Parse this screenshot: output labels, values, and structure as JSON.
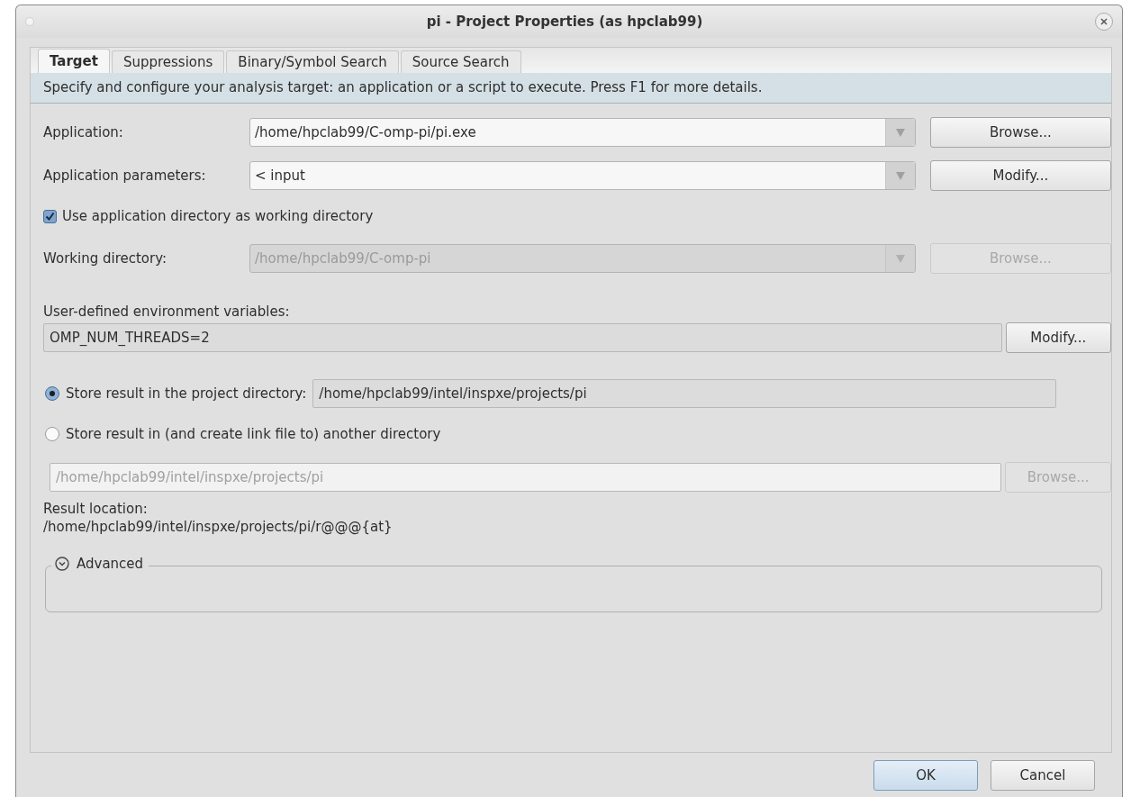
{
  "window": {
    "title": "pi - Project Properties (as hpclab99)"
  },
  "tabs": [
    {
      "label": "Target",
      "selected": true
    },
    {
      "label": "Suppressions",
      "selected": false
    },
    {
      "label": "Binary/Symbol Search",
      "selected": false
    },
    {
      "label": "Source Search",
      "selected": false
    }
  ],
  "info": "Specify and configure your analysis target: an application or a script to execute. Press F1 for more details.",
  "combo_rows": [
    {
      "label": "Application:",
      "value": "/home/hpclab99/C-omp-pi/pi.exe",
      "disabled": false,
      "button": {
        "label": "Browse...",
        "disabled": false
      }
    },
    {
      "label": "Application parameters:",
      "value": "< input",
      "disabled": false,
      "button": {
        "label": "Modify...",
        "disabled": false
      }
    }
  ],
  "use_app_dir": {
    "label": "Use application directory as working directory",
    "checked": true
  },
  "working_directory": {
    "label": "Working directory:",
    "value": "/home/hpclab99/C-omp-pi",
    "disabled": true,
    "button": {
      "label": "Browse...",
      "disabled": true
    }
  },
  "environment": {
    "label": "User-defined environment variables:",
    "value": "OMP_NUM_THREADS=2",
    "button": {
      "label": "Modify...",
      "disabled": false
    }
  },
  "store_options": [
    {
      "label": "Store result in the project directory:",
      "selected": true,
      "value": "/home/hpclab99/intel/inspxe/projects/pi"
    },
    {
      "label": "Store result in (and create link file to) another directory",
      "selected": false
    }
  ],
  "other_directory": {
    "value": "/home/hpclab99/intel/inspxe/projects/pi",
    "disabled": true,
    "button": {
      "label": "Browse...",
      "disabled": true
    }
  },
  "result_location": {
    "label": "Result location:",
    "value": "/home/hpclab99/intel/inspxe/projects/pi/r@@@{at}"
  },
  "advanced": {
    "label": "Advanced",
    "expanded": false
  },
  "buttons": [
    {
      "label": "OK",
      "default": true
    },
    {
      "label": "Cancel",
      "default": false
    }
  ]
}
